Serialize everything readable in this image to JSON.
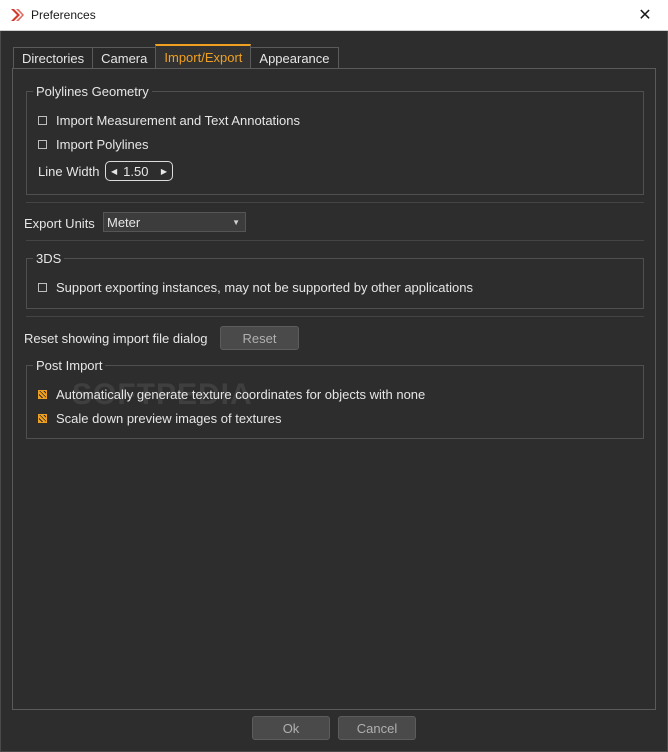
{
  "window": {
    "title": "Preferences",
    "close_glyph": "✕"
  },
  "tabs": [
    {
      "label": "Directories",
      "active": false
    },
    {
      "label": "Camera",
      "active": false
    },
    {
      "label": "Import/Export",
      "active": true
    },
    {
      "label": "Appearance",
      "active": false
    }
  ],
  "polylines": {
    "title": "Polylines Geometry",
    "import_annotations": {
      "label": "Import Measurement and Text Annotations",
      "checked": false
    },
    "import_polylines": {
      "label": "Import Polylines",
      "checked": false
    },
    "line_width_label": "Line Width",
    "line_width_value": "1.50"
  },
  "export_units": {
    "label": "Export Units",
    "value": "Meter"
  },
  "three_ds": {
    "title": "3DS",
    "support_instances": {
      "label": "Support exporting instances, may not be supported by other applications",
      "checked": false
    }
  },
  "reset": {
    "label": "Reset showing import file dialog",
    "button": "Reset"
  },
  "post_import": {
    "title": "Post Import",
    "auto_texcoords": {
      "label": "Automatically generate texture coordinates for objects with none",
      "checked": true
    },
    "scale_previews": {
      "label": "Scale down preview images of textures",
      "checked": true
    }
  },
  "footer": {
    "ok": "Ok",
    "cancel": "Cancel"
  },
  "watermark": "SOFTPEDIA",
  "colors": {
    "accent": "#f0a020",
    "background": "#2d2d2d",
    "text": "#e6e6e6"
  }
}
